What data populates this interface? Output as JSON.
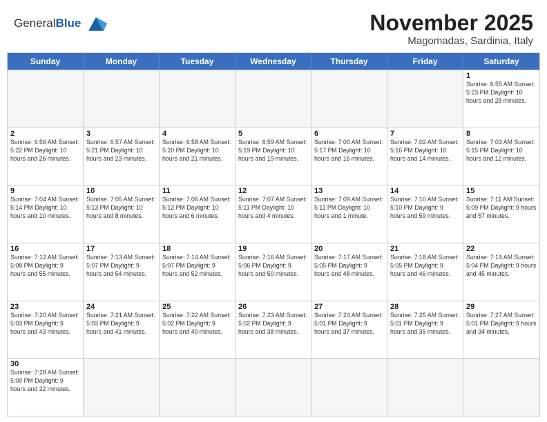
{
  "header": {
    "logo_general": "General",
    "logo_blue": "Blue",
    "month_title": "November 2025",
    "subtitle": "Magomadas, Sardinia, Italy"
  },
  "days_of_week": [
    "Sunday",
    "Monday",
    "Tuesday",
    "Wednesday",
    "Thursday",
    "Friday",
    "Saturday"
  ],
  "weeks": [
    [
      {
        "day": "",
        "info": "",
        "empty": true
      },
      {
        "day": "",
        "info": "",
        "empty": true
      },
      {
        "day": "",
        "info": "",
        "empty": true
      },
      {
        "day": "",
        "info": "",
        "empty": true
      },
      {
        "day": "",
        "info": "",
        "empty": true
      },
      {
        "day": "",
        "info": "",
        "empty": true
      },
      {
        "day": "1",
        "info": "Sunrise: 6:55 AM\nSunset: 5:23 PM\nDaylight: 10 hours\nand 28 minutes.",
        "empty": false
      }
    ],
    [
      {
        "day": "2",
        "info": "Sunrise: 6:56 AM\nSunset: 5:22 PM\nDaylight: 10 hours\nand 26 minutes.",
        "empty": false
      },
      {
        "day": "3",
        "info": "Sunrise: 6:57 AM\nSunset: 5:21 PM\nDaylight: 10 hours\nand 23 minutes.",
        "empty": false
      },
      {
        "day": "4",
        "info": "Sunrise: 6:58 AM\nSunset: 5:20 PM\nDaylight: 10 hours\nand 21 minutes.",
        "empty": false
      },
      {
        "day": "5",
        "info": "Sunrise: 6:59 AM\nSunset: 5:19 PM\nDaylight: 10 hours\nand 19 minutes.",
        "empty": false
      },
      {
        "day": "6",
        "info": "Sunrise: 7:00 AM\nSunset: 5:17 PM\nDaylight: 10 hours\nand 16 minutes.",
        "empty": false
      },
      {
        "day": "7",
        "info": "Sunrise: 7:02 AM\nSunset: 5:16 PM\nDaylight: 10 hours\nand 14 minutes.",
        "empty": false
      },
      {
        "day": "8",
        "info": "Sunrise: 7:03 AM\nSunset: 5:15 PM\nDaylight: 10 hours\nand 12 minutes.",
        "empty": false
      }
    ],
    [
      {
        "day": "9",
        "info": "Sunrise: 7:04 AM\nSunset: 5:14 PM\nDaylight: 10 hours\nand 10 minutes.",
        "empty": false
      },
      {
        "day": "10",
        "info": "Sunrise: 7:05 AM\nSunset: 5:13 PM\nDaylight: 10 hours\nand 8 minutes.",
        "empty": false
      },
      {
        "day": "11",
        "info": "Sunrise: 7:06 AM\nSunset: 5:12 PM\nDaylight: 10 hours\nand 6 minutes.",
        "empty": false
      },
      {
        "day": "12",
        "info": "Sunrise: 7:07 AM\nSunset: 5:11 PM\nDaylight: 10 hours\nand 4 minutes.",
        "empty": false
      },
      {
        "day": "13",
        "info": "Sunrise: 7:09 AM\nSunset: 5:11 PM\nDaylight: 10 hours\nand 1 minute.",
        "empty": false
      },
      {
        "day": "14",
        "info": "Sunrise: 7:10 AM\nSunset: 5:10 PM\nDaylight: 9 hours\nand 59 minutes.",
        "empty": false
      },
      {
        "day": "15",
        "info": "Sunrise: 7:11 AM\nSunset: 5:09 PM\nDaylight: 9 hours\nand 57 minutes.",
        "empty": false
      }
    ],
    [
      {
        "day": "16",
        "info": "Sunrise: 7:12 AM\nSunset: 5:08 PM\nDaylight: 9 hours\nand 55 minutes.",
        "empty": false
      },
      {
        "day": "17",
        "info": "Sunrise: 7:13 AM\nSunset: 5:07 PM\nDaylight: 9 hours\nand 54 minutes.",
        "empty": false
      },
      {
        "day": "18",
        "info": "Sunrise: 7:14 AM\nSunset: 5:07 PM\nDaylight: 9 hours\nand 52 minutes.",
        "empty": false
      },
      {
        "day": "19",
        "info": "Sunrise: 7:16 AM\nSunset: 5:06 PM\nDaylight: 9 hours\nand 50 minutes.",
        "empty": false
      },
      {
        "day": "20",
        "info": "Sunrise: 7:17 AM\nSunset: 5:05 PM\nDaylight: 9 hours\nand 48 minutes.",
        "empty": false
      },
      {
        "day": "21",
        "info": "Sunrise: 7:18 AM\nSunset: 5:05 PM\nDaylight: 9 hours\nand 46 minutes.",
        "empty": false
      },
      {
        "day": "22",
        "info": "Sunrise: 7:19 AM\nSunset: 5:04 PM\nDaylight: 9 hours\nand 45 minutes.",
        "empty": false
      }
    ],
    [
      {
        "day": "23",
        "info": "Sunrise: 7:20 AM\nSunset: 5:03 PM\nDaylight: 9 hours\nand 43 minutes.",
        "empty": false
      },
      {
        "day": "24",
        "info": "Sunrise: 7:21 AM\nSunset: 5:03 PM\nDaylight: 9 hours\nand 41 minutes.",
        "empty": false
      },
      {
        "day": "25",
        "info": "Sunrise: 7:22 AM\nSunset: 5:02 PM\nDaylight: 9 hours\nand 40 minutes.",
        "empty": false
      },
      {
        "day": "26",
        "info": "Sunrise: 7:23 AM\nSunset: 5:02 PM\nDaylight: 9 hours\nand 38 minutes.",
        "empty": false
      },
      {
        "day": "27",
        "info": "Sunrise: 7:24 AM\nSunset: 5:01 PM\nDaylight: 9 hours\nand 37 minutes.",
        "empty": false
      },
      {
        "day": "28",
        "info": "Sunrise: 7:25 AM\nSunset: 5:01 PM\nDaylight: 9 hours\nand 35 minutes.",
        "empty": false
      },
      {
        "day": "29",
        "info": "Sunrise: 7:27 AM\nSunset: 5:01 PM\nDaylight: 9 hours\nand 34 minutes.",
        "empty": false
      }
    ],
    [
      {
        "day": "30",
        "info": "Sunrise: 7:28 AM\nSunset: 5:00 PM\nDaylight: 9 hours\nand 32 minutes.",
        "empty": false
      },
      {
        "day": "",
        "info": "",
        "empty": true
      },
      {
        "day": "",
        "info": "",
        "empty": true
      },
      {
        "day": "",
        "info": "",
        "empty": true
      },
      {
        "day": "",
        "info": "",
        "empty": true
      },
      {
        "day": "",
        "info": "",
        "empty": true
      },
      {
        "day": "",
        "info": "",
        "empty": true
      }
    ]
  ]
}
